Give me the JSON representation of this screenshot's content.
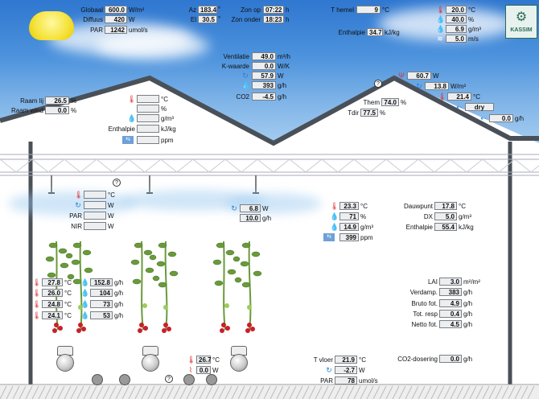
{
  "weather": {
    "globaal": {
      "label": "Globaal",
      "value": "600.0",
      "unit": "W/m²"
    },
    "diffuus": {
      "label": "Diffuus",
      "value": "420",
      "unit": "W"
    },
    "par": {
      "label": "PAR",
      "value": "1242",
      "unit": "umol/s"
    },
    "az": {
      "label": "Az",
      "value": "183.4",
      "unit": "°"
    },
    "el": {
      "label": "El",
      "value": "30.5",
      "unit": "°"
    },
    "zon_op": {
      "label": "Zon op",
      "value": "07:22",
      "unit": "h"
    },
    "zon_onder": {
      "label": "Zon onder",
      "value": "18:23",
      "unit": "h"
    },
    "t_hemel": {
      "label": "T hemel",
      "value": "9",
      "unit": "°C"
    },
    "enthalpie": {
      "label": "Enthalpie",
      "value": "34.7",
      "unit": "kJ/kg"
    },
    "temp": {
      "value": "20.0",
      "unit": "°C"
    },
    "rh": {
      "value": "40.0",
      "unit": "%"
    },
    "ah": {
      "value": "6.9",
      "unit": "g/m³"
    },
    "wind": {
      "value": "5.0",
      "unit": "m/s"
    }
  },
  "logo": {
    "text": "KASSIM"
  },
  "ventilation": {
    "ventilatie": {
      "label": "Ventilatie",
      "value": "49.0",
      "unit": "m³/h"
    },
    "kwaarde": {
      "label": "K-waarde",
      "value": "0.0",
      "unit": "W/K"
    },
    "heat": {
      "value": "57.9",
      "unit": "W"
    },
    "vapour": {
      "value": "393",
      "unit": "g/h"
    },
    "co2": {
      "label": "CO2",
      "value": "-4.5",
      "unit": "g/h"
    }
  },
  "windows": {
    "raam_lij": {
      "label": "Raam lij",
      "value": "26.5",
      "unit": "%"
    },
    "raam_wind": {
      "label": "Raam wind",
      "value": "0.0",
      "unit": "%"
    }
  },
  "upper_air": {
    "temp": {
      "value": "",
      "unit": "°C"
    },
    "rh": {
      "value": "",
      "unit": "%"
    },
    "ah": {
      "value": "",
      "unit": "g/m³"
    },
    "enthalpie": {
      "label": "Enthalpie",
      "value": "",
      "unit": "kJ/kg"
    },
    "co2": {
      "value": "",
      "unit": "ppm"
    }
  },
  "screen": {
    "heat": {
      "value": "60.7",
      "unit": "W"
    },
    "rad": {
      "value": "13.8",
      "unit": "W/m²"
    },
    "temp": {
      "value": "21.4",
      "unit": "°C"
    },
    "state": {
      "value": "dry"
    },
    "cond": {
      "value": "0.0",
      "unit": "g/h"
    },
    "them": {
      "label": "Them",
      "value": "74.0",
      "unit": "%"
    },
    "tdir": {
      "label": "Tdir",
      "value": "77.5",
      "unit": "%"
    }
  },
  "lamps": {
    "temp": {
      "value": "",
      "unit": "°C"
    },
    "heat": {
      "value": "",
      "unit": "W"
    },
    "par": {
      "label": "PAR",
      "value": "",
      "unit": "W"
    },
    "nir": {
      "label": "NIR",
      "value": "",
      "unit": "W"
    }
  },
  "fog": {
    "heat": {
      "value": "6.8",
      "unit": "W"
    },
    "water": {
      "value": "10.0",
      "unit": "g/h"
    }
  },
  "greenhouse_air": {
    "temp": {
      "value": "23.3",
      "unit": "°C"
    },
    "rh": {
      "value": "71",
      "unit": "%"
    },
    "ah": {
      "value": "14.9",
      "unit": "g/m³"
    },
    "co2": {
      "value": "399",
      "unit": "ppm"
    },
    "dauwpunt": {
      "label": "Dauwpunt",
      "value": "17.8",
      "unit": "°C"
    },
    "dx": {
      "label": "DX",
      "value": "5.0",
      "unit": "g/m³"
    },
    "enthalpie": {
      "label": "Enthalpie",
      "value": "55.4",
      "unit": "kJ/kg"
    }
  },
  "crop_layers": [
    {
      "temp": "27.8",
      "flow": "152.8",
      "unit_t": "°C",
      "unit_f": "g/h"
    },
    {
      "temp": "26.0",
      "flow": "104",
      "unit_t": "°C",
      "unit_f": "g/h"
    },
    {
      "temp": "24.8",
      "flow": "73",
      "unit_t": "°C",
      "unit_f": "g/h"
    },
    {
      "temp": "24.1",
      "flow": "53",
      "unit_t": "°C",
      "unit_f": "g/h"
    }
  ],
  "crop": {
    "lai": {
      "label": "LAI",
      "value": "3.0",
      "unit": "m²/m²"
    },
    "verdamp": {
      "label": "Verdamp.",
      "value": "383",
      "unit": "g/h"
    },
    "bruto": {
      "label": "Bruto fot.",
      "value": "4.9",
      "unit": "g/h"
    },
    "resp": {
      "label": "Tot. resp",
      "value": "0.4",
      "unit": "g/h"
    },
    "netto": {
      "label": "Netto fot.",
      "value": "4.5",
      "unit": "g/h"
    }
  },
  "pipes": {
    "temp": {
      "value": "26.7",
      "unit": "°C"
    },
    "heat": {
      "value": "0.0",
      "unit": "W"
    }
  },
  "floor": {
    "t_vloer": {
      "label": "T vloer",
      "value": "21.9",
      "unit": "°C"
    },
    "heat": {
      "value": "-2.7",
      "unit": "W"
    },
    "par": {
      "label": "PAR",
      "value": "78",
      "unit": "umol/s"
    }
  },
  "co2_dosing": {
    "label": "CO2-dosering",
    "value": "0.0",
    "unit": "g/h"
  },
  "help": "?",
  "colors": {
    "sky": "#2f77d0",
    "roof": "#4a5058",
    "leaf": "#6a9a3a",
    "tomato": "#c8202a"
  }
}
